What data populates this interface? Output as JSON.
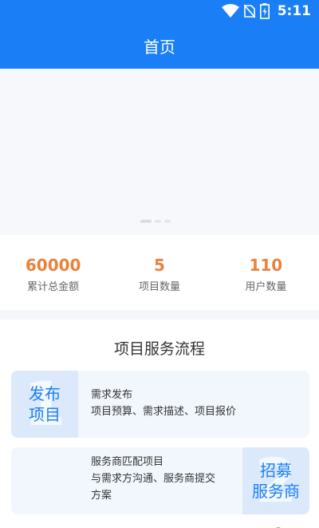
{
  "status": {
    "time": "5:11",
    "icons": [
      "wifi-icon",
      "no-sim-icon",
      "battery-charging-icon"
    ]
  },
  "header": {
    "title": "首页"
  },
  "stats": [
    {
      "value": "60000",
      "label": "累计总金额"
    },
    {
      "value": "5",
      "label": "项目数量"
    },
    {
      "value": "110",
      "label": "用户数量"
    }
  ],
  "process": {
    "title": "项目服务流程",
    "steps": [
      {
        "number": "1",
        "badge": "发布\n项目",
        "line1": "需求发布",
        "line2": "项目预算、需求描述、项目报价",
        "line3": ""
      },
      {
        "number": "2",
        "badge": "招募\n服务商",
        "line1": "服务商匹配项目",
        "line2": "与需求方沟通、服务商提交",
        "line3": "方案"
      }
    ]
  },
  "colors": {
    "primary": "#1a7ff7",
    "accent": "#e8823a"
  }
}
